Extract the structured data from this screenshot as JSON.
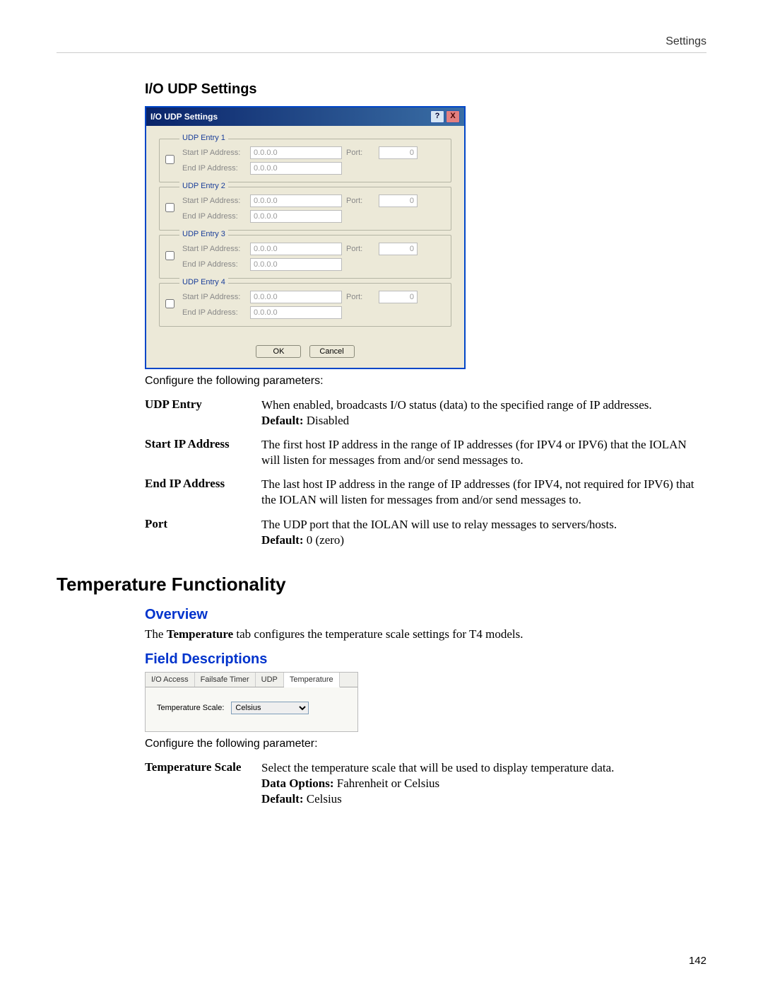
{
  "header": {
    "right": "Settings"
  },
  "section1": {
    "title": "I/O UDP Settings",
    "intro": "Configure the following parameters:"
  },
  "dialog": {
    "title": "I/O UDP Settings",
    "help": "?",
    "close": "X",
    "entries": [
      {
        "legend": "UDP Entry 1",
        "start_label": "Start IP Address:",
        "start_val": "0.0.0.0",
        "end_label": "End IP Address:",
        "end_val": "0.0.0.0",
        "port_label": "Port:",
        "port_val": "0"
      },
      {
        "legend": "UDP Entry 2",
        "start_label": "Start IP Address:",
        "start_val": "0.0.0.0",
        "end_label": "End IP Address:",
        "end_val": "0.0.0.0",
        "port_label": "Port:",
        "port_val": "0"
      },
      {
        "legend": "UDP Entry 3",
        "start_label": "Start IP Address:",
        "start_val": "0.0.0.0",
        "end_label": "End IP Address:",
        "end_val": "0.0.0.0",
        "port_label": "Port:",
        "port_val": "0"
      },
      {
        "legend": "UDP Entry 4",
        "start_label": "Start IP Address:",
        "start_val": "0.0.0.0",
        "end_label": "End IP Address:",
        "end_val": "0.0.0.0",
        "port_label": "Port:",
        "port_val": "0"
      }
    ],
    "ok": "OK",
    "cancel": "Cancel"
  },
  "params1": [
    {
      "label": "UDP Entry",
      "desc": "When enabled, broadcasts I/O status (data) to the specified range of IP addresses.",
      "default_prefix": "Default:",
      "default_val": " Disabled"
    },
    {
      "label": "Start IP Address",
      "desc": "The first host IP address in the range of IP addresses (for IPV4 or IPV6) that the IOLAN will listen for messages from and/or send messages to."
    },
    {
      "label": "End IP Address",
      "desc": "The last host IP address in the range of IP addresses (for IPV4, not required for IPV6) that the IOLAN will listen for messages from and/or send messages to."
    },
    {
      "label": "Port",
      "desc": "The UDP port that the IOLAN will use to relay messages to servers/hosts.",
      "default_prefix": "Default:",
      "default_val": " 0 (zero)"
    }
  ],
  "section2": {
    "title": "Temperature Functionality",
    "overview_title": "Overview",
    "overview_pre": "The ",
    "overview_bold": "Temperature",
    "overview_post": " tab configures the temperature scale settings for T4 models.",
    "fields_title": "Field Descriptions",
    "intro2": "Configure the following parameter:"
  },
  "temp_panel": {
    "tabs": [
      "I/O Access",
      "Failsafe Timer",
      "UDP",
      "Temperature"
    ],
    "active_tab_index": 3,
    "scale_label": "Temperature Scale:",
    "scale_value": "Celsius"
  },
  "params2": [
    {
      "label": "Temperature Scale",
      "desc": "Select the temperature scale that will be used to display temperature data.",
      "options_prefix": "Data Options:",
      "options_val": " Fahrenheit or Celsius",
      "default_prefix": "Default:",
      "default_val": " Celsius"
    }
  ],
  "page_number": "142"
}
